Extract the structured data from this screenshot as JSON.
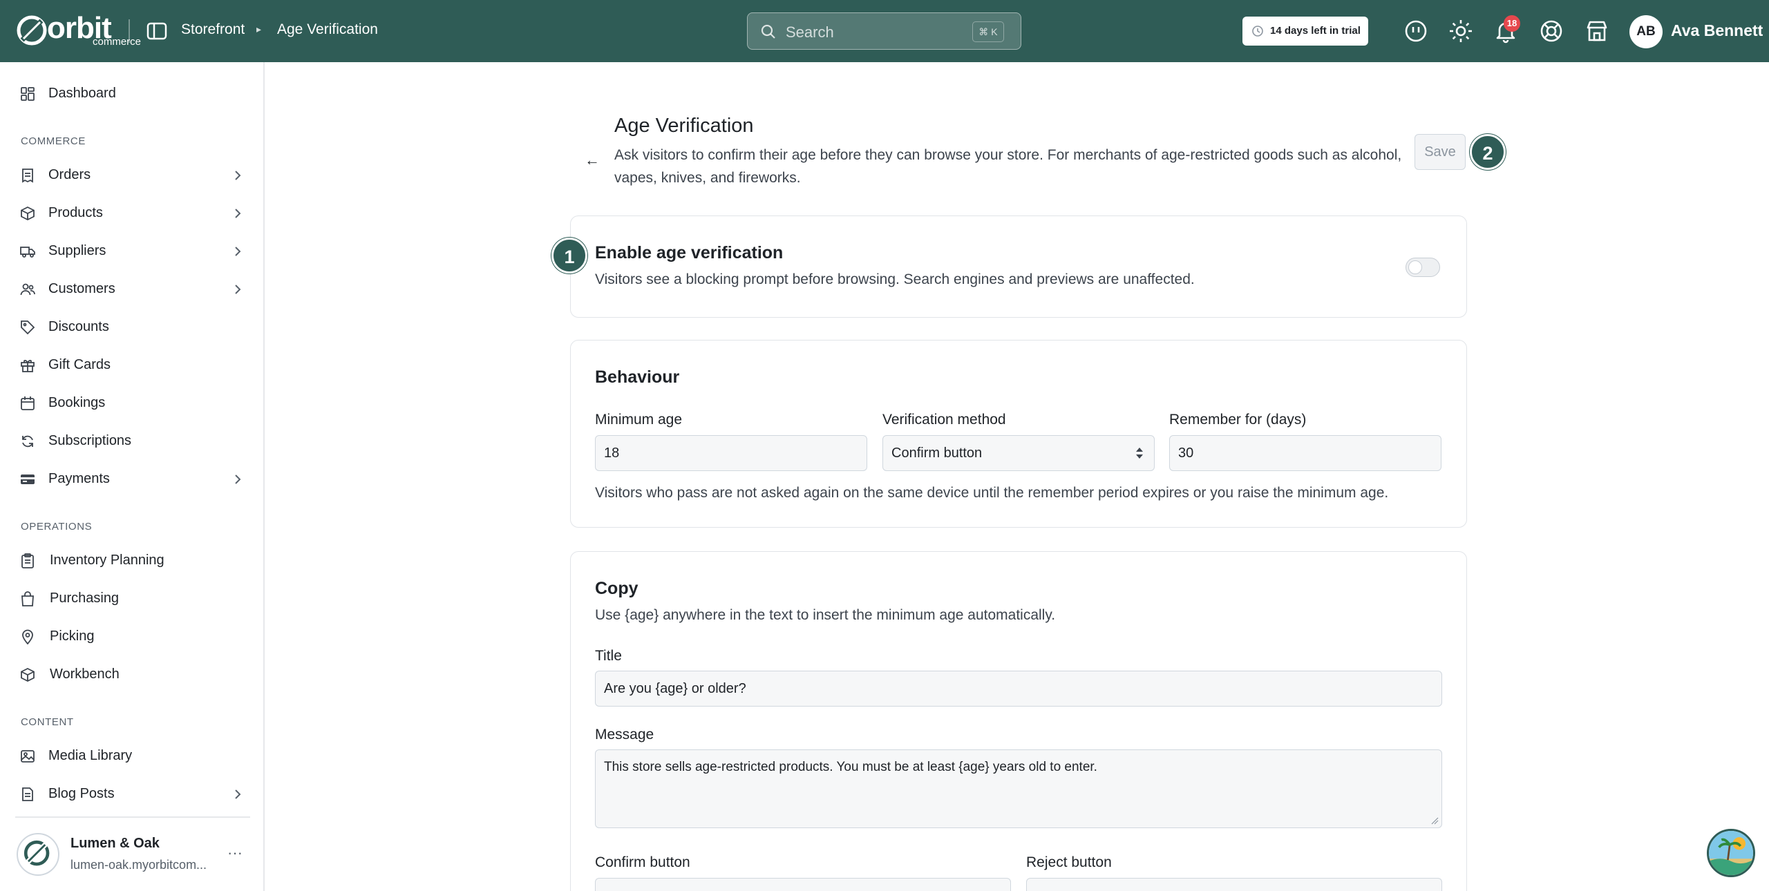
{
  "topbar": {
    "logo_word": "orbit",
    "logo_sub": "commerce",
    "breadcrumb": [
      "Storefront",
      "Age Verification"
    ],
    "search_placeholder": "Search",
    "search_shortcut": "⌘ K",
    "trial_text": "14 days left in trial",
    "notification_count": "18",
    "user_initials": "AB",
    "user_name": "Ava Bennett"
  },
  "sidebar": {
    "dashboard": "Dashboard",
    "commerce_label": "COMMERCE",
    "commerce_items": [
      {
        "label": "Orders",
        "icon": "receipt-icon",
        "has_children": true
      },
      {
        "label": "Products",
        "icon": "box-icon",
        "has_children": true
      },
      {
        "label": "Suppliers",
        "icon": "truck-icon",
        "has_children": true
      },
      {
        "label": "Customers",
        "icon": "users-icon",
        "has_children": true
      },
      {
        "label": "Discounts",
        "icon": "tag-icon",
        "has_children": false
      },
      {
        "label": "Gift Cards",
        "icon": "gift-icon",
        "has_children": false
      },
      {
        "label": "Bookings",
        "icon": "calendar-icon",
        "has_children": false
      },
      {
        "label": "Subscriptions",
        "icon": "refresh-icon",
        "has_children": false
      },
      {
        "label": "Payments",
        "icon": "credit-card-icon",
        "has_children": true
      }
    ],
    "operations_label": "OPERATIONS",
    "operations_items": [
      {
        "label": "Inventory Planning",
        "icon": "clipboard-icon"
      },
      {
        "label": "Purchasing",
        "icon": "shopping-bag-icon"
      },
      {
        "label": "Picking",
        "icon": "map-pin-icon"
      },
      {
        "label": "Workbench",
        "icon": "box-icon"
      }
    ],
    "content_label": "CONTENT",
    "content_items": [
      {
        "label": "Media Library",
        "icon": "image-icon",
        "has_children": false
      },
      {
        "label": "Blog Posts",
        "icon": "document-icon",
        "has_children": true
      }
    ],
    "store_name": "Lumen & Oak",
    "store_url": "lumen-oak.myorbitcom...",
    "store_menu": "···"
  },
  "page": {
    "title": "Age Verification",
    "description": "Ask visitors to confirm their age before they can browse your store. For merchants of age-restricted goods such as alcohol, vapes, knives, and fireworks.",
    "back_label": "←",
    "save_label": "Save",
    "step_badges": [
      "1",
      "2"
    ]
  },
  "enable_card": {
    "title": "Enable age verification",
    "description": "Visitors see a blocking prompt before browsing. Search engines and previews are unaffected.",
    "enabled": false
  },
  "behaviour_card": {
    "title": "Behaviour",
    "min_age_label": "Minimum age",
    "min_age_value": "18",
    "method_label": "Verification method",
    "method_value": "Confirm button",
    "remember_label": "Remember for (days)",
    "remember_value": "30",
    "help": "Visitors who pass are not asked again on the same device until the remember period expires or you raise the minimum age."
  },
  "copy_card": {
    "title": "Copy",
    "description": "Use {age} anywhere in the text to insert the minimum age automatically.",
    "title_label": "Title",
    "title_value": "Are you {age} or older?",
    "message_label": "Message",
    "message_value": "This store sells age-restricted products. You must be at least {age} years old to enter.",
    "confirm_label": "Confirm button",
    "reject_label": "Reject button"
  },
  "colors": {
    "brand": "#2f5c56",
    "badge": "#e5484d"
  }
}
